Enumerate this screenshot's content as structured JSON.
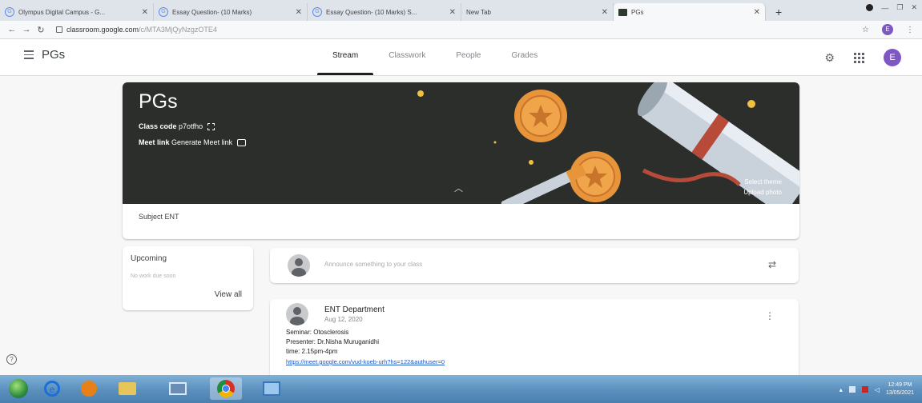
{
  "browser": {
    "tabs": [
      {
        "title": "Olympus Digital Campus - G...",
        "active": false
      },
      {
        "title": "Essay Question- (10 Marks)",
        "active": false
      },
      {
        "title": "Essay Question- (10 Marks) S...",
        "active": false
      },
      {
        "title": "New Tab",
        "active": false
      },
      {
        "title": "PGs",
        "active": true
      }
    ],
    "new_tab": "+",
    "url_host": "classroom.google.com",
    "url_path": "/c/MTA3MjQyNzgzOTE4",
    "profile_initial": "E"
  },
  "classroom": {
    "class_name": "PGs",
    "nav": {
      "stream": "Stream",
      "classwork": "Classwork",
      "people": "People",
      "grades": "Grades"
    },
    "avatar_initial": "E",
    "banner": {
      "title": "PGs",
      "class_code_label": "Class code",
      "class_code": "p7otfho",
      "meet_label": "Meet link",
      "meet_action": "Generate Meet link",
      "select_theme": "Select theme",
      "upload_photo": "Upload photo"
    },
    "subject": "Subject ENT",
    "upcoming": {
      "title": "Upcoming",
      "subtitle": "No work due soon",
      "view_all": "View all"
    },
    "announce_placeholder": "Announce something to your class",
    "post": {
      "author": "ENT Department",
      "date": "Aug 12, 2020",
      "line1": "Seminar: Otosclerosis",
      "line2": "Presenter: Dr.Nisha Muruganidhi",
      "line3": "time: 2.15pm-4pm",
      "link": "https://meet.google.com/vud-koeb-urh?hs=122&authuser=0"
    },
    "help": "?"
  },
  "taskbar": {
    "time": "12:49 PM",
    "date": "13/05/2021"
  },
  "colors": {
    "banner_bg": "#2c2e2c",
    "accent_avatar": "#7e57c2",
    "link": "#1a56c8",
    "medal": "#e8943a"
  }
}
